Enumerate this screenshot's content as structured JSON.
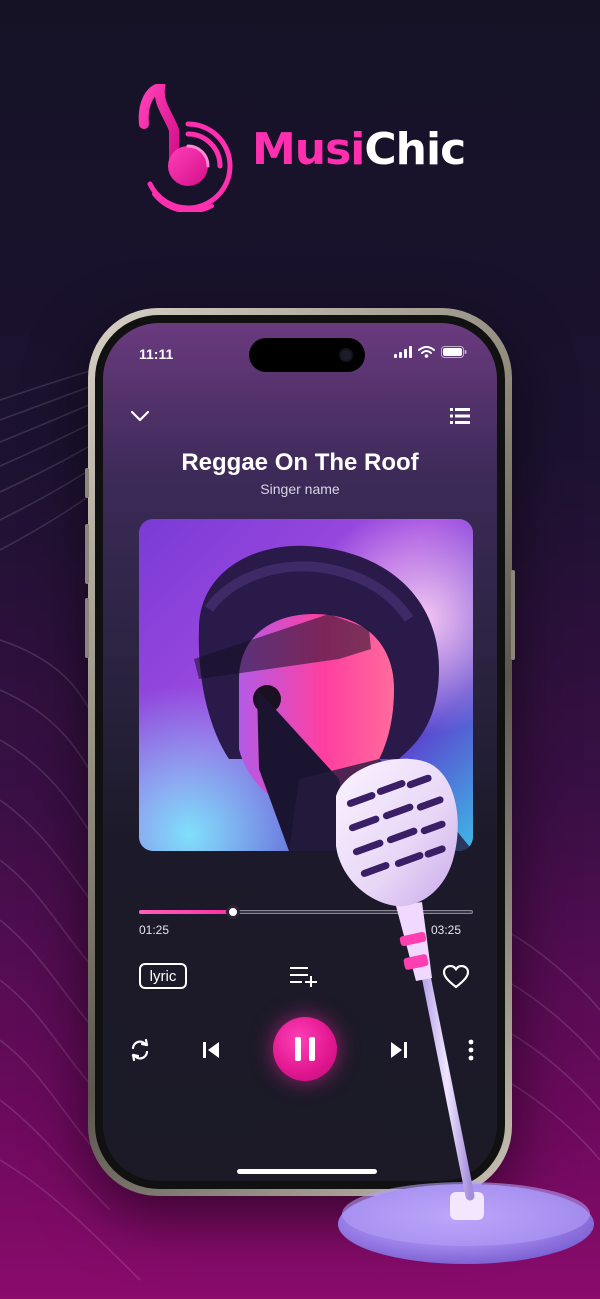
{
  "brand": {
    "name_part1": "Musi",
    "name_part2": "Chic",
    "logo_icon": "music-note-icon",
    "accent": "#ff2fb0"
  },
  "status_bar": {
    "time": "11:11",
    "icons": [
      "signal-icon",
      "wifi-icon",
      "battery-icon"
    ]
  },
  "player": {
    "song_title": "Reggae On The Roof",
    "singer": "Singer name",
    "current_time": "01:25",
    "total_time": "03:25",
    "progress": 0.28,
    "lyric_label": "lyric",
    "accent": "#e0168f"
  },
  "icons": {
    "collapse": "chevron-down-icon",
    "queue": "list-icon",
    "add_to_playlist": "playlist-add-icon",
    "favorite": "heart-icon",
    "repeat": "repeat-icon",
    "previous": "skip-previous-icon",
    "play_pause": "pause-icon",
    "next": "skip-next-icon",
    "more": "more-vertical-icon"
  },
  "decoration": {
    "microphone": "microphone-icon"
  }
}
